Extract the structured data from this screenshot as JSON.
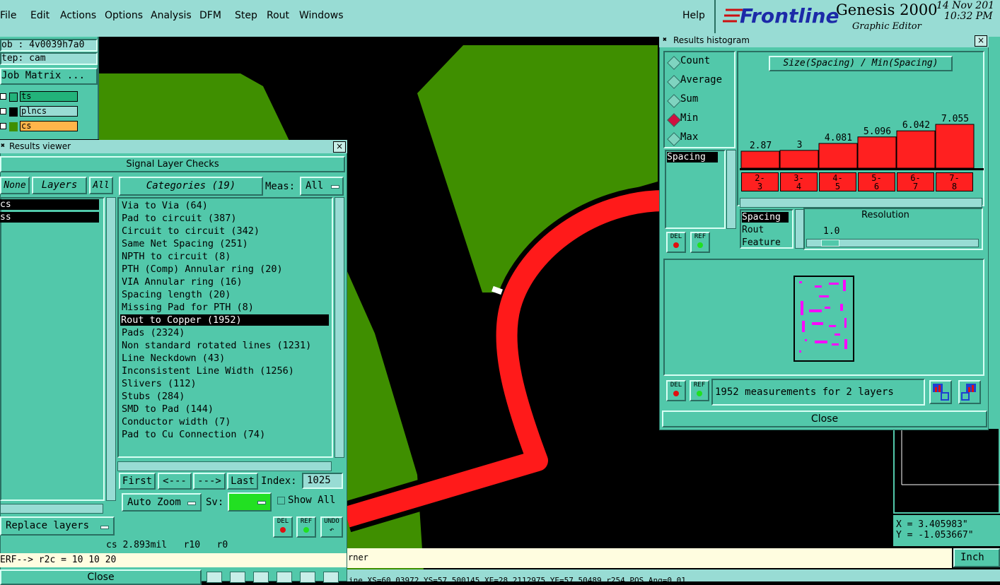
{
  "menu": [
    "File",
    "Edit",
    "Actions",
    "Options",
    "Analysis",
    "DFM",
    "Step",
    "Rout",
    "Windows"
  ],
  "help": "Help",
  "brand": {
    "logo": "Frontline",
    "product": "Genesis 2000",
    "subtitle": "Graphic Editor",
    "date": "14 Nov 201",
    "time": "10:32 PM"
  },
  "job_panel": {
    "job": "ob : 4v0039h7a0",
    "step": "tep: cam",
    "matrix_btn": "Job Matrix ...",
    "layers": [
      {
        "name": "ts",
        "color": "#22b27a"
      },
      {
        "name": "plncs",
        "color": "#98dcd4"
      },
      {
        "name": "cs",
        "color": "#ffb54a"
      }
    ]
  },
  "results_viewer": {
    "title": "Results viewer",
    "header": "Signal Layer Checks",
    "none_btn": "None",
    "layers_btn": "Layers",
    "all_btn": "All",
    "categories_btn": "Categories (19)",
    "meas_label": "Meas:",
    "meas_value": "All",
    "layer_list": [
      "cs",
      "ss"
    ],
    "categories": [
      "Via to Via (64)",
      "Pad to circuit (387)",
      "Circuit to circuit (342)",
      "Same Net Spacing (251)",
      "NPTH to circuit (8)",
      "PTH (Comp) Annular ring (20)",
      "VIA Annular ring (16)",
      "Spacing length (20)",
      "Missing Pad for PTH (8)",
      "Rout to Copper (1952)",
      "Pads (2324)",
      "Non standard rotated lines (1231)",
      "Line Neckdown (43)",
      "Inconsistent Line Width (1256)",
      "Slivers (112)",
      "Stubs (284)",
      "SMD to Pad (144)",
      "Conductor width (7)",
      "Pad to Cu Connection (74)"
    ],
    "selected_index": 9,
    "first_btn": "First",
    "prev_btn": "<---",
    "next_btn": "--->",
    "last_btn": "Last",
    "index_label": "Index:",
    "index_value": "1025",
    "zoom_btn": "Auto Zoom",
    "sv_label": "Sv:",
    "show_all": "Show All",
    "replace_btn": "Replace layers",
    "del": "DEL",
    "ref": "REF",
    "undo": "UNDO",
    "status": "cs 2.893mil   r10   r0",
    "command": "ERF--> r2c = 10 10 20",
    "close_btn": "Close"
  },
  "histogram": {
    "title": "Results histogram",
    "options": [
      "Count",
      "Average",
      "Sum",
      "Min",
      "Max"
    ],
    "selected_option": "Min",
    "chart_title": "Size(Spacing) / Min(Spacing)",
    "list_item": "Spacing",
    "attr_list": [
      "Spacing",
      "Rout",
      "Feature"
    ],
    "resolution_label": "Resolution",
    "resolution_value": "1.0",
    "del": "DEL",
    "ref": "REF",
    "measurements": "1952 measurements for 2 layers",
    "close_btn": "Close"
  },
  "chart_data": {
    "type": "bar",
    "title": "Size(Spacing) / Min(Spacing)",
    "categories": [
      "2-3",
      "3-4",
      "4-5",
      "5-6",
      "6-7",
      "7-8"
    ],
    "values": [
      2.87,
      3,
      4.081,
      5.096,
      6.042,
      7.055
    ],
    "value_labels": [
      "2.87",
      "3",
      "4.081",
      "5.096",
      "6.042",
      "7.055"
    ],
    "bin_labels": [
      [
        "2-",
        "3"
      ],
      [
        "3-",
        "4"
      ],
      [
        "4-",
        "5"
      ],
      [
        "5-",
        "6"
      ],
      [
        "6-",
        "7"
      ],
      [
        "7-",
        "8"
      ]
    ],
    "bar_color": "#ff2020"
  },
  "canvas": {
    "bottom_text": "rner",
    "bottom_status": "ine XS=60.03972 YS=57.500145 XE=28.2112975 YE=57.50489 r254 POS Ang=0.01"
  },
  "coords": {
    "x": "X = 3.405983\"",
    "y": "Y = -1.053667\""
  },
  "unit": "Inch",
  "colors": {
    "copper": "#3f8f00",
    "rout": "#ff1a1a",
    "panel": "#52c8aa",
    "marker": "#ff00ff"
  }
}
